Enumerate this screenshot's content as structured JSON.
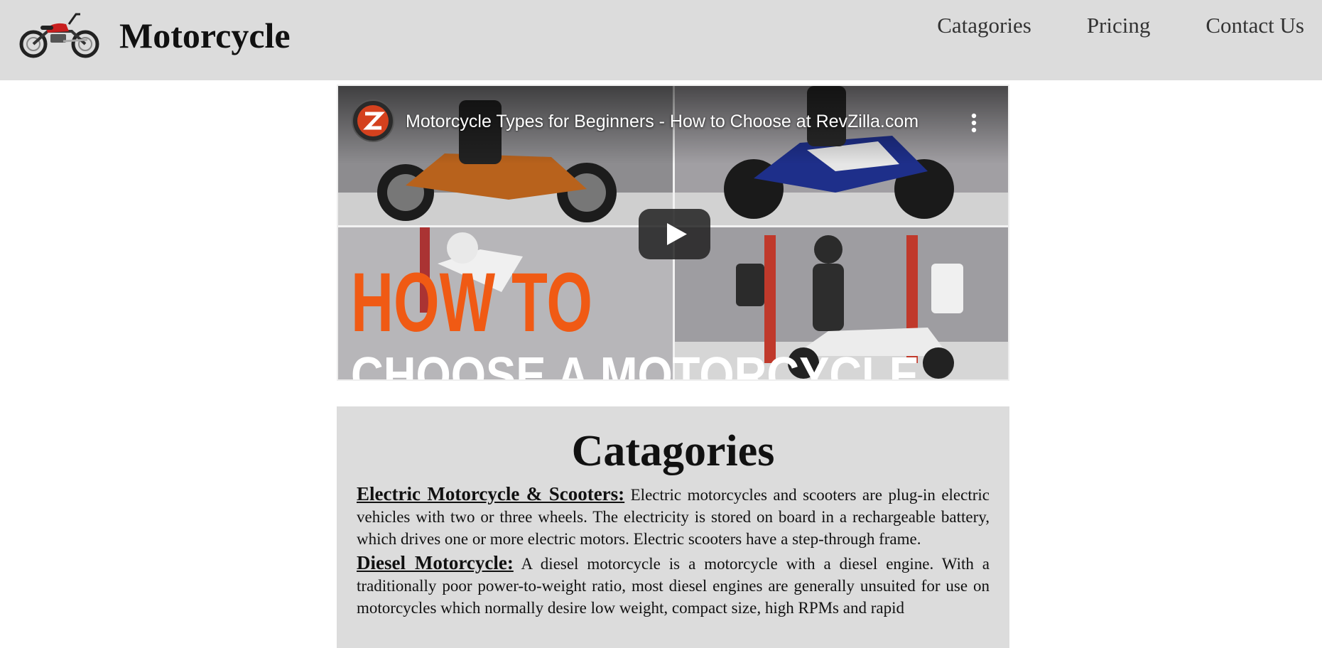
{
  "header": {
    "brand": "Motorcycle",
    "nav": [
      "Catagories",
      "Pricing",
      "Contact Us"
    ]
  },
  "video": {
    "title": "Motorcycle Types for Beginners - How to Choose at RevZilla.com",
    "overlay_line1": "HOW TO",
    "overlay_line2": "CHOOSE A MOTORCYCLE",
    "play_icon": "play-icon",
    "menu_icon": "kebab-menu-icon",
    "accent_color": "#f05a14"
  },
  "categories": {
    "heading": "Catagories",
    "items": [
      {
        "term": "Electric Motorcycle & Scooters:",
        "text": " Electric motorcycles and scooters are plug-in electric vehicles with two or three wheels. The electricity is stored on board in a rechargeable battery, which drives one or more electric motors. Electric scooters have a step-through frame."
      },
      {
        "term": "Diesel Motorcycle:",
        "text": " A diesel motorcycle is a motorcycle with a diesel engine. With a traditionally poor power-to-weight ratio, most diesel engines are generally unsuited for use on motorcycles which normally desire low weight, compact size, high RPMs and rapid"
      }
    ]
  }
}
